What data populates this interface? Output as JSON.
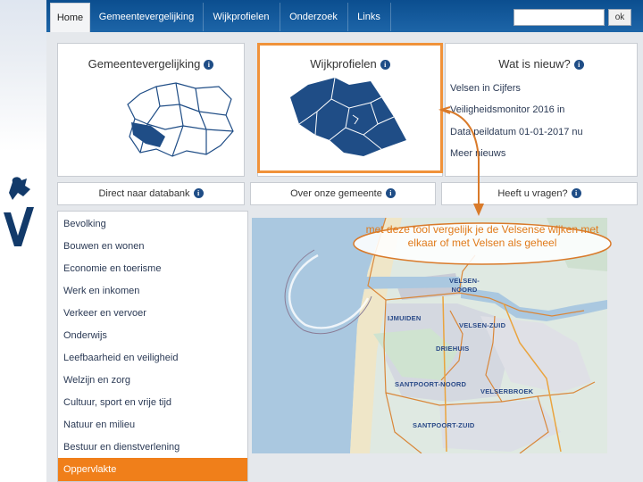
{
  "nav": {
    "items": [
      "Home",
      "Gemeentevergelijking",
      "Wijkprofielen",
      "Onderzoek",
      "Links"
    ],
    "ok_label": "ok"
  },
  "panels": {
    "gemeente_title": "Gemeentevergelijking",
    "wijk_title": "Wijkprofielen",
    "nieuw_title": "Wat is nieuw?"
  },
  "news": [
    "Velsen in Cijfers",
    "Veiligheidsmonitor 2016 in",
    "Data peildatum 01-01-2017 nu",
    "Meer nieuws"
  ],
  "bottom_buttons": [
    "Direct naar databank",
    "Over onze gemeente",
    "Heeft u vragen?"
  ],
  "menu": {
    "items": [
      "Bevolking",
      "Bouwen en wonen",
      "Economie en toerisme",
      "Werk en inkomen",
      "Verkeer en vervoer",
      "Onderwijs",
      "Leefbaarheid en veiligheid",
      "Welzijn en zorg",
      "Cultuur, sport en vrije tijd",
      "Natuur en milieu",
      "Bestuur en dienstverlening"
    ],
    "active": "Oppervlakte"
  },
  "callout": "met deze tool vergelijk je de Velsense wijken met elkaar of met Velsen als geheel",
  "map_labels": [
    "VELSEN-NOORD",
    "IJMUIDEN",
    "VELSEN-ZUID",
    "DRIEHUIS",
    "SANTPOORT-NOORD",
    "VELSERBROEK",
    "SANTPOORT-ZUID"
  ],
  "colors": {
    "accent": "#f07f1a",
    "nav_blue": "#0b4e8f",
    "map_shape": "#1f4d86"
  }
}
